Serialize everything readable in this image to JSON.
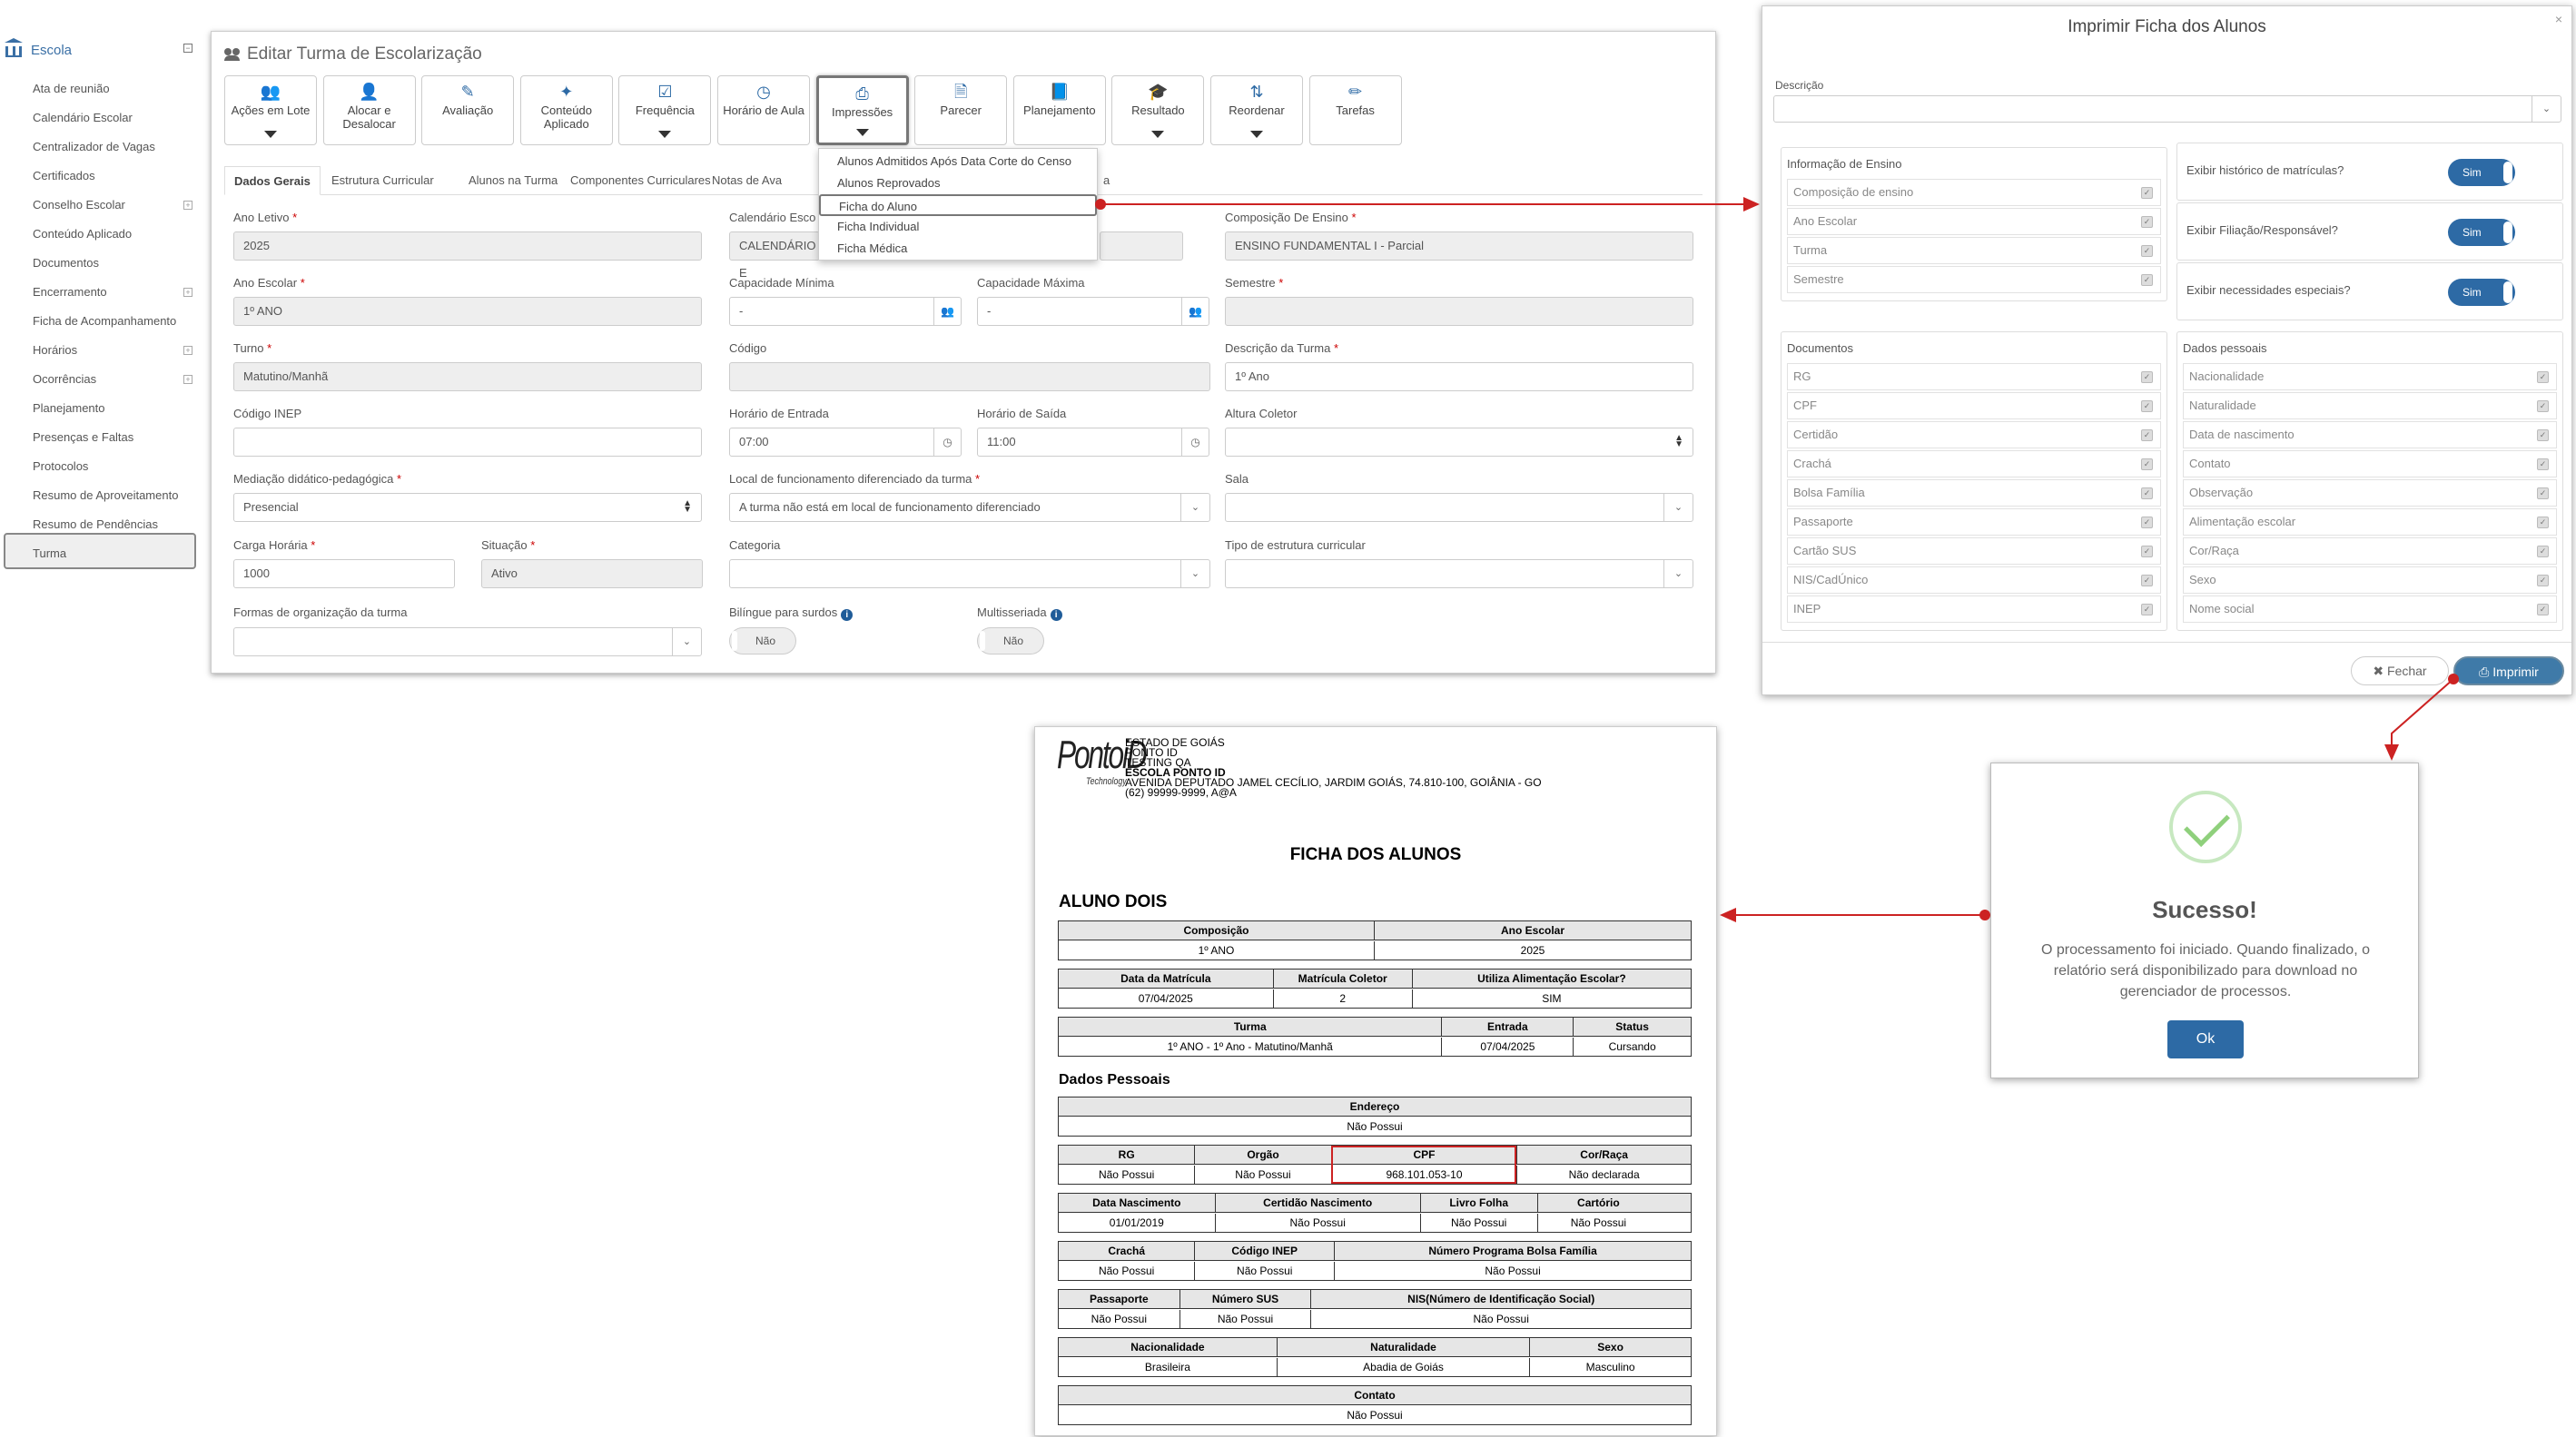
{
  "sidebar": {
    "header": "Escola",
    "items": [
      {
        "label": "Ata de reunião",
        "expandable": false
      },
      {
        "label": "Calendário Escolar",
        "expandable": false
      },
      {
        "label": "Centralizador de Vagas",
        "expandable": false
      },
      {
        "label": "Certificados",
        "expandable": false
      },
      {
        "label": "Conselho Escolar",
        "expandable": true
      },
      {
        "label": "Conteúdo Aplicado",
        "expandable": false
      },
      {
        "label": "Documentos",
        "expandable": false
      },
      {
        "label": "Encerramento",
        "expandable": true
      },
      {
        "label": "Ficha de Acompanhamento",
        "expandable": false
      },
      {
        "label": "Horários",
        "expandable": true
      },
      {
        "label": "Ocorrências",
        "expandable": true
      },
      {
        "label": "Planejamento",
        "expandable": false
      },
      {
        "label": "Presenças e Faltas",
        "expandable": false
      },
      {
        "label": "Protocolos",
        "expandable": false
      },
      {
        "label": "Resumo de Aproveitamento",
        "expandable": false
      },
      {
        "label": "Resumo de Pendências",
        "expandable": false
      },
      {
        "label": "Turma",
        "expandable": false,
        "active": true
      }
    ]
  },
  "panel": {
    "title": "Editar Turma de Escolarização",
    "toolbar": [
      {
        "label": "Ações em Lote",
        "icon": "users-icon",
        "dropdown": true
      },
      {
        "label": "Alocar e Desalocar",
        "icon": "user-plus-icon",
        "dropdown": false
      },
      {
        "label": "Avaliação",
        "icon": "edit-icon",
        "dropdown": false
      },
      {
        "label": "Conteúdo Aplicado",
        "icon": "magic-wand-icon",
        "dropdown": false
      },
      {
        "label": "Frequência",
        "icon": "checkbox-icon",
        "dropdown": true
      },
      {
        "label": "Horário de Aula",
        "icon": "clock-icon",
        "dropdown": false
      },
      {
        "label": "Impressões",
        "icon": "printer-icon",
        "dropdown": true,
        "active": true
      },
      {
        "label": "Parecer",
        "icon": "file-icon",
        "dropdown": false
      },
      {
        "label": "Planejamento",
        "icon": "book-icon",
        "dropdown": false
      },
      {
        "label": "Resultado",
        "icon": "graduation-cap-icon",
        "dropdown": true
      },
      {
        "label": "Reordenar",
        "icon": "sort-alpha-icon",
        "dropdown": true
      },
      {
        "label": "Tarefas",
        "icon": "pencil-icon",
        "dropdown": false
      }
    ],
    "tabs": [
      "Dados Gerais",
      "Estrutura Curricular",
      "Alunos na Turma",
      "Componentes Curriculares",
      "Notas de Ava",
      "a"
    ],
    "fields": {
      "ano_letivo": {
        "label": "Ano Letivo",
        "required": true,
        "value": "2025"
      },
      "calendario_escolar": {
        "label": "Calendário Esco",
        "required": false,
        "value": "CALENDÁRIO E"
      },
      "composicao_ensino": {
        "label": "Composição De Ensino",
        "required": true,
        "value": "ENSINO FUNDAMENTAL I - Parcial"
      },
      "ano_escolar": {
        "label": "Ano Escolar",
        "required": true,
        "value": "1º ANO"
      },
      "capacidade_minima": {
        "label": "Capacidade Mínima",
        "value": "-"
      },
      "capacidade_maxima": {
        "label": "Capacidade Máxima",
        "value": "-"
      },
      "semestre": {
        "label": "Semestre",
        "required": true,
        "value": ""
      },
      "turno": {
        "label": "Turno",
        "required": true,
        "value": "Matutino/Manhã"
      },
      "codigo": {
        "label": "Código",
        "value": ""
      },
      "descricao_turma": {
        "label": "Descrição da Turma",
        "required": true,
        "value": "1º Ano"
      },
      "codigo_inep": {
        "label": "Código INEP",
        "value": ""
      },
      "horario_entrada": {
        "label": "Horário de Entrada",
        "value": "07:00"
      },
      "horario_saida": {
        "label": "Horário de Saída",
        "value": "11:00"
      },
      "altura_coletor": {
        "label": "Altura Coletor",
        "value": ""
      },
      "mediacao": {
        "label": "Mediação didático-pedagógica",
        "required": true,
        "value": "Presencial"
      },
      "local_funcionamento": {
        "label": "Local de funcionamento diferenciado da turma",
        "required": true,
        "value": "A turma não está em local de funcionamento diferenciado"
      },
      "sala": {
        "label": "Sala",
        "value": ""
      },
      "carga_horaria": {
        "label": "Carga Horária",
        "required": true,
        "value": "1000"
      },
      "situacao": {
        "label": "Situação",
        "required": true,
        "value": "Ativo"
      },
      "categoria": {
        "label": "Categoria",
        "value": ""
      },
      "tipo_estrutura": {
        "label": "Tipo de estrutura curricular",
        "value": ""
      },
      "formas_organizacao": {
        "label": "Formas de organização da turma",
        "value": ""
      },
      "bilingue": {
        "label": "Bilíngue para surdos",
        "value": "Não"
      },
      "multisseriada": {
        "label": "Multisseriada",
        "value": "Não"
      }
    },
    "print_menu": [
      "Alunos Admitidos Após Data Corte do Censo",
      "Alunos Reprovados",
      "Ficha do Aluno",
      "Ficha Individual",
      "Ficha Médica"
    ]
  },
  "modal": {
    "title": "Imprimir Ficha dos Alunos",
    "close": "×",
    "descricao_label": "Descrição",
    "info_ensino": {
      "legend": "Informação de Ensino",
      "items": [
        "Composição de ensino",
        "Ano Escolar",
        "Turma",
        "Semestre"
      ]
    },
    "options": [
      {
        "label": "Exibir histórico de matrículas?",
        "value": "Sim"
      },
      {
        "label": "Exibir Filiação/Responsável?",
        "value": "Sim"
      },
      {
        "label": "Exibir necessidades especiais?",
        "value": "Sim"
      }
    ],
    "documentos": {
      "legend": "Documentos",
      "items": [
        "RG",
        "CPF",
        "Certidão",
        "Crachá",
        "Bolsa Família",
        "Passaporte",
        "Cartão SUS",
        "NIS/CadÚnico",
        "INEP"
      ]
    },
    "dados_pessoais": {
      "legend": "Dados pessoais",
      "items": [
        "Nacionalidade",
        "Naturalidade",
        "Data de nascimento",
        "Contato",
        "Observação",
        "Alimentação escolar",
        "Cor/Raça",
        "Sexo",
        "Nome social"
      ]
    },
    "fechar": "Fechar",
    "imprimir": "Imprimir"
  },
  "success": {
    "title": "Sucesso!",
    "message": "O processamento foi iniciado. Quando finalizado, o relatório será disponibilizado para download no gerenciador de processos.",
    "ok": "Ok"
  },
  "report": {
    "logo_main": "PontoiD",
    "logo_sub": "Technology",
    "header_lines": [
      "ESTADO DE GOIÁS",
      "PONTO ID",
      "TESTING QA",
      "ESCOLA PONTO ID",
      "AVENIDA DEPUTADO JAMEL CECÍLIO, JARDIM GOIÁS, 74.810-100, GOIÂNIA - GO",
      "(62) 99999-9999, A@A"
    ],
    "title": "FICHA DOS ALUNOS",
    "student": "ALUNO DOIS",
    "t1": {
      "h": [
        "Composição",
        "Ano Escolar"
      ],
      "v": [
        "1º ANO",
        "2025"
      ]
    },
    "t2": {
      "h": [
        "Data da Matrícula",
        "Matrícula Coletor",
        "Utiliza Alimentação Escolar?"
      ],
      "v": [
        "07/04/2025",
        "2",
        "SIM"
      ]
    },
    "t3": {
      "h": [
        "Turma",
        "Entrada",
        "Status"
      ],
      "v": [
        "1º ANO - 1º Ano - Matutino/Manhã",
        "07/04/2025",
        "Cursando"
      ]
    },
    "dados_pessoais": "Dados Pessoais",
    "t4": {
      "h": [
        "Endereço"
      ],
      "v": [
        "Não Possui"
      ]
    },
    "t5": {
      "h": [
        "RG",
        "Orgão",
        "CPF",
        "Cor/Raça"
      ],
      "v": [
        "Não Possui",
        "Não Possui",
        "968.101.053-10",
        "Não declarada"
      ]
    },
    "t6": {
      "h": [
        "Data Nascimento",
        "Certidão Nascimento",
        "Livro Folha",
        "Cartório"
      ],
      "v": [
        "01/01/2019",
        "Não Possui",
        "Não Possui",
        "Não Possui"
      ]
    },
    "t7": {
      "h": [
        "Crachá",
        "Código INEP",
        "Número Programa Bolsa Família"
      ],
      "v": [
        "Não Possui",
        "Não Possui",
        "Não Possui"
      ]
    },
    "t8": {
      "h": [
        "Passaporte",
        "Número SUS",
        "NIS(Número de Identificação Social)"
      ],
      "v": [
        "Não Possui",
        "Não Possui",
        "Não Possui"
      ]
    },
    "t9": {
      "h": [
        "Nacionalidade",
        "Naturalidade",
        "Sexo"
      ],
      "v": [
        "Brasileira",
        "Abadia de Goiás",
        "Masculino"
      ]
    },
    "t10": {
      "h": [
        "Contato"
      ],
      "v": [
        "Não Possui"
      ]
    }
  },
  "colors": {
    "accent": "#2d6aa5",
    "annotation": "#cc2222",
    "ok_button": "#2d6aa5"
  }
}
